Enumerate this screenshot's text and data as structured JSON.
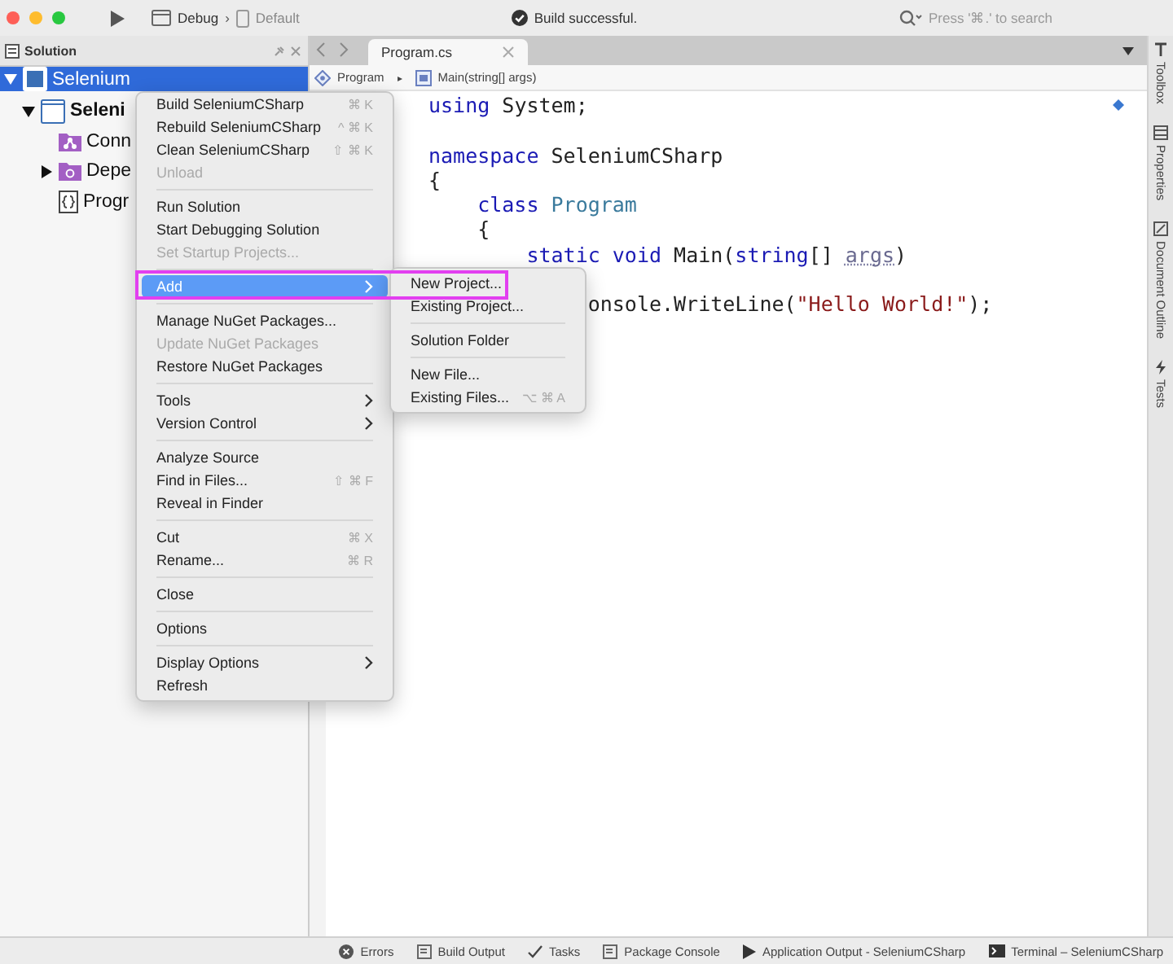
{
  "toolbar": {
    "configuration": "Debug",
    "separator": "›",
    "device": "Default",
    "status": "Build successful.",
    "search": {
      "placeholder": "Press '⌘.' to search"
    }
  },
  "solution_pad": {
    "title": "Solution",
    "tree": [
      {
        "label": "Selenium",
        "kind": "solution",
        "expanded": true,
        "selected": true,
        "children": [
          {
            "label": "Seleni",
            "kind": "project",
            "expanded": true,
            "selected": false,
            "children": [
              {
                "label": "Conn",
                "kind": "connected",
                "selected": false
              },
              {
                "label": "Depe",
                "kind": "dependencies",
                "expanded": false,
                "selected": false
              },
              {
                "label": "Progr",
                "kind": "file",
                "selected": false
              }
            ]
          }
        ]
      }
    ]
  },
  "editor": {
    "tabs": [
      {
        "label": "Program.cs",
        "selected": true
      }
    ],
    "breadcrumb": [
      "Program",
      "▸",
      "Main(string[] args)"
    ],
    "lines": [
      {
        "kind": "code",
        "tokens": [
          {
            "text": "using",
            "kind": "keyword"
          },
          {
            "text": " System;",
            "kind": "plain"
          }
        ]
      },
      {
        "kind": "blank"
      },
      {
        "kind": "code",
        "tokens": [
          {
            "text": "namespace",
            "kind": "keyword"
          },
          {
            "text": " SeleniumCSharp",
            "kind": "plain"
          }
        ]
      },
      {
        "kind": "code",
        "tokens": [
          {
            "text": "{",
            "kind": "plain"
          }
        ]
      },
      {
        "kind": "code",
        "tokens": [
          {
            "text": "    class",
            "kind": "keyword"
          },
          {
            "text": " Program",
            "kind": "type"
          }
        ]
      },
      {
        "kind": "code",
        "tokens": [
          {
            "text": "    {",
            "kind": "plain"
          }
        ]
      },
      {
        "kind": "code",
        "tokens": [
          {
            "text": "        static",
            "kind": "keyword"
          },
          {
            "text": " void",
            "kind": "keyword"
          },
          {
            "text": " Main(",
            "kind": "plain"
          },
          {
            "text": "string",
            "kind": "keyword"
          },
          {
            "text": "[] ",
            "kind": "plain"
          },
          {
            "text": "args",
            "kind": "param"
          },
          {
            "text": ")",
            "kind": "plain"
          }
        ]
      },
      {
        "kind": "blank"
      },
      {
        "kind": "code",
        "tokens": [
          {
            "text": "             onsole.WriteLine(",
            "kind": "plain"
          },
          {
            "text": "\"Hello World!\"",
            "kind": "string"
          },
          {
            "text": ");",
            "kind": "plain"
          }
        ]
      }
    ]
  },
  "context_menu": [
    {
      "kind": "item",
      "label": "Build SeleniumCSharp",
      "shortcut": "⌘ K",
      "disabled": false,
      "selected": false
    },
    {
      "kind": "item",
      "label": "Rebuild SeleniumCSharp",
      "shortcut": "^ ⌘ K",
      "disabled": false,
      "selected": false
    },
    {
      "kind": "item",
      "label": "Clean SeleniumCSharp",
      "shortcut": "⇧ ⌘ K",
      "disabled": false,
      "selected": false
    },
    {
      "kind": "item",
      "label": "Unload",
      "disabled": true,
      "selected": false
    },
    {
      "kind": "separator"
    },
    {
      "kind": "item",
      "label": "Run Solution",
      "disabled": false,
      "selected": false
    },
    {
      "kind": "item",
      "label": "Start Debugging Solution",
      "disabled": false,
      "selected": false
    },
    {
      "kind": "item",
      "label": "Set Startup Projects...",
      "disabled": true,
      "selected": false
    },
    {
      "kind": "separator"
    },
    {
      "kind": "submenu",
      "label": "Add",
      "disabled": false,
      "selected": true
    },
    {
      "kind": "separator"
    },
    {
      "kind": "item",
      "label": "Manage NuGet Packages...",
      "disabled": false,
      "selected": false
    },
    {
      "kind": "item",
      "label": "Update NuGet Packages",
      "disabled": true,
      "selected": false
    },
    {
      "kind": "item",
      "label": "Restore NuGet Packages",
      "disabled": false,
      "selected": false
    },
    {
      "kind": "separator"
    },
    {
      "kind": "submenu",
      "label": "Tools",
      "disabled": false,
      "selected": false
    },
    {
      "kind": "submenu",
      "label": "Version Control",
      "disabled": false,
      "selected": false
    },
    {
      "kind": "separator"
    },
    {
      "kind": "item",
      "label": "Analyze Source",
      "disabled": false,
      "selected": false
    },
    {
      "kind": "item",
      "label": "Find in Files...",
      "shortcut": "⇧ ⌘ F",
      "disabled": false,
      "selected": false
    },
    {
      "kind": "item",
      "label": "Reveal in Finder",
      "disabled": false,
      "selected": false
    },
    {
      "kind": "separator"
    },
    {
      "kind": "item",
      "label": "Cut",
      "shortcut": "⌘ X",
      "disabled": false,
      "selected": false
    },
    {
      "kind": "item",
      "label": "Rename...",
      "shortcut": "⌘ R",
      "disabled": false,
      "selected": false
    },
    {
      "kind": "separator"
    },
    {
      "kind": "item",
      "label": "Close",
      "disabled": false,
      "selected": false
    },
    {
      "kind": "separator"
    },
    {
      "kind": "item",
      "label": "Options",
      "disabled": false,
      "selected": false
    },
    {
      "kind": "separator"
    },
    {
      "kind": "submenu",
      "label": "Display Options",
      "disabled": false,
      "selected": false
    },
    {
      "kind": "item",
      "label": "Refresh",
      "disabled": false,
      "selected": false
    }
  ],
  "submenu": [
    {
      "kind": "item",
      "label": "New Project...",
      "disabled": false,
      "selected": false
    },
    {
      "kind": "item",
      "label": "Existing Project...",
      "disabled": false,
      "selected": false
    },
    {
      "kind": "separator"
    },
    {
      "kind": "item",
      "label": "Solution Folder",
      "disabled": false,
      "selected": false
    },
    {
      "kind": "separator"
    },
    {
      "kind": "item",
      "label": "New File...",
      "disabled": false,
      "selected": false
    },
    {
      "kind": "item",
      "label": "Existing Files...",
      "shortcut": "⌥ ⌘ A",
      "disabled": false,
      "selected": false
    }
  ],
  "side_tabs": [
    {
      "label": "Toolbox",
      "kind": "toolbox"
    },
    {
      "label": "Properties",
      "kind": "properties"
    },
    {
      "label": "Document Outline",
      "kind": "outline"
    },
    {
      "label": "Tests",
      "kind": "tests"
    }
  ],
  "status_bar": [
    {
      "label": "Errors",
      "kind": "errors"
    },
    {
      "label": "Build Output",
      "kind": "build"
    },
    {
      "label": "Tasks",
      "kind": "tasks"
    },
    {
      "label": "Package Console",
      "kind": "package"
    },
    {
      "label": "Application Output - SeleniumCSharp",
      "kind": "output"
    },
    {
      "label": "Terminal – SeleniumCSharp",
      "kind": "terminal"
    }
  ]
}
